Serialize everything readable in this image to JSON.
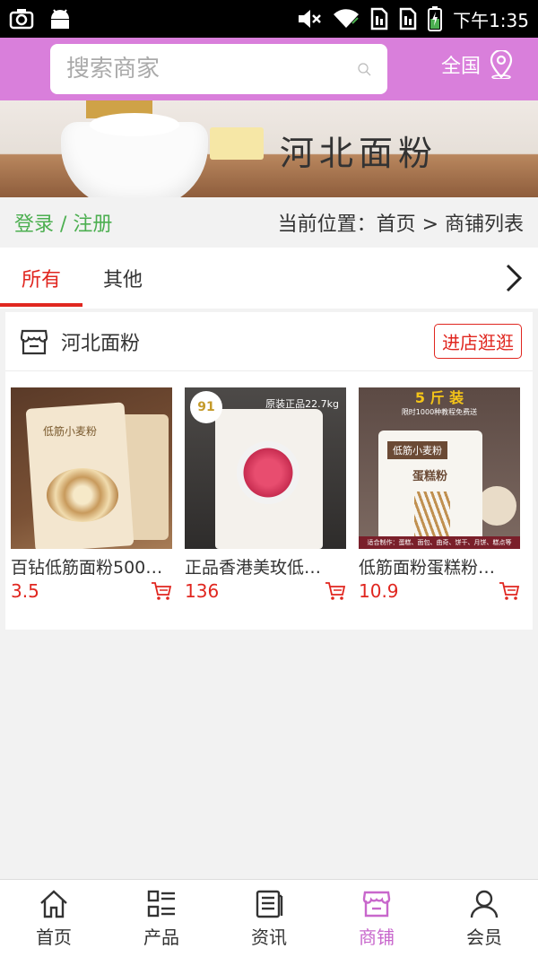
{
  "status_bar": {
    "time": "下午1:35",
    "icons": [
      "screenshot-icon",
      "android-icon",
      "mute-icon",
      "wifi-icon",
      "sim1-icon",
      "sim2-icon",
      "battery-icon"
    ]
  },
  "header": {
    "search_placeholder": "搜索商家",
    "region_label": "全国",
    "bg_color": "#d97fdb"
  },
  "banner": {
    "title": "河北面粉"
  },
  "location_row": {
    "auth_label": "登录 / 注册",
    "breadcrumb": "当前位置：首页 > 商铺列表"
  },
  "tabs": [
    {
      "label": "所有",
      "active": true
    },
    {
      "label": "其他",
      "active": false
    }
  ],
  "store": {
    "name": "河北面粉",
    "visit_button": "进店逛逛",
    "products": [
      {
        "name": "百钻低筋面粉500…",
        "price": "3.5",
        "thumb": {
          "label": "低筋小麦粉"
        }
      },
      {
        "name": "正品香港美玫低…",
        "price": "136",
        "thumb": {
          "tag": "91",
          "header": "原装正品22.7kg"
        }
      },
      {
        "name": "低筋面粉蛋糕粉…",
        "price": "10.9",
        "thumb": {
          "top": "5 斤 装",
          "sub": "限时1000种教程免费送",
          "bag_name": "低筋小麦粉",
          "bag_sub": "蛋糕粉",
          "foot": "适合制作：蛋糕、面包、曲奇、饼干、月饼、糕点等"
        }
      }
    ]
  },
  "bottom_nav": [
    {
      "label": "首页",
      "icon": "home-icon",
      "active": false
    },
    {
      "label": "产品",
      "icon": "list-icon",
      "active": false
    },
    {
      "label": "资讯",
      "icon": "news-icon",
      "active": false
    },
    {
      "label": "商铺",
      "icon": "store-icon",
      "active": true
    },
    {
      "label": "会员",
      "icon": "user-icon",
      "active": false
    }
  ],
  "colors": {
    "accent_red": "#e0261f",
    "active_purple": "#c867cc",
    "auth_green": "#4caf50"
  }
}
